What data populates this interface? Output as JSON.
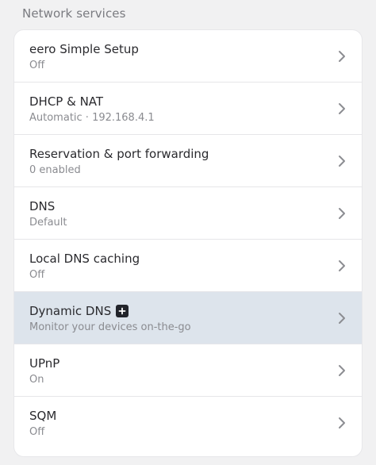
{
  "section": {
    "title": "Network services"
  },
  "items": [
    {
      "title": "eero Simple Setup",
      "subtitle": "Off"
    },
    {
      "title": "DHCP & NAT",
      "subtitle": "Automatic · 192.168.4.1"
    },
    {
      "title": "Reservation & port forwarding",
      "subtitle": "0 enabled"
    },
    {
      "title": "DNS",
      "subtitle": "Default"
    },
    {
      "title": "Local DNS caching",
      "subtitle": "Off"
    },
    {
      "title": "Dynamic DNS",
      "subtitle": "Monitor your devices on-the-go",
      "badge": "plus-icon"
    },
    {
      "title": "UPnP",
      "subtitle": "On"
    },
    {
      "title": "SQM",
      "subtitle": "Off"
    }
  ],
  "colors": {
    "highlight": "#dde4ec",
    "accent": "#22242b"
  }
}
